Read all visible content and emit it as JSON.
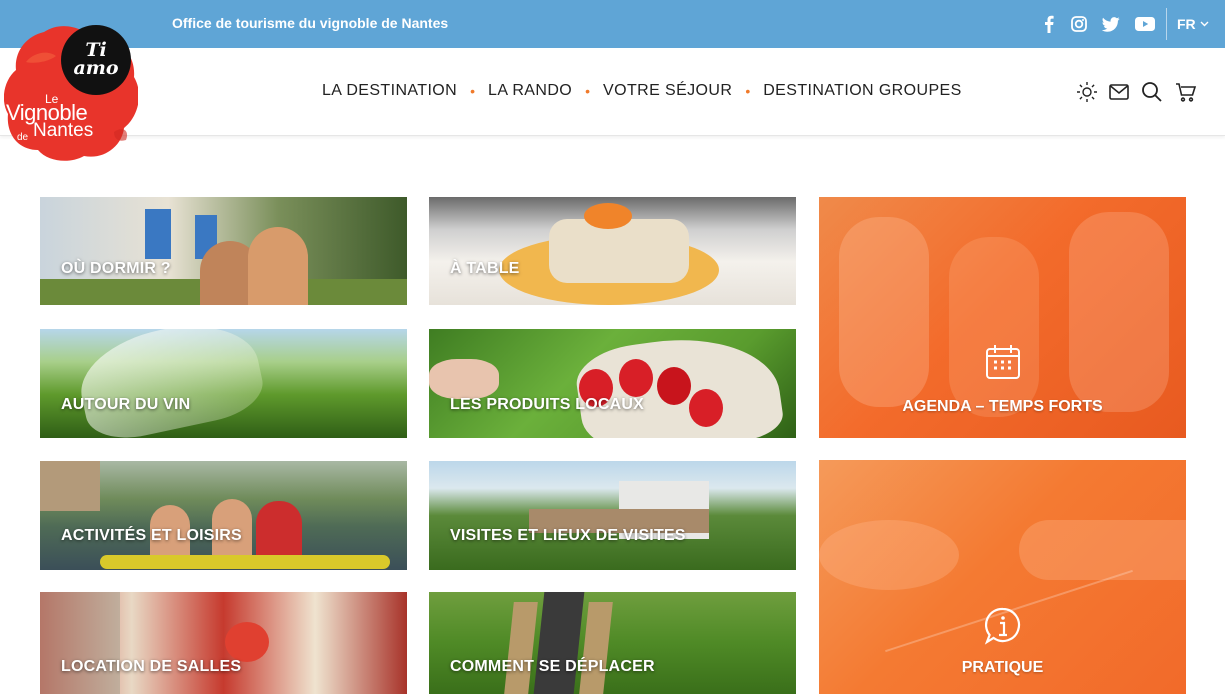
{
  "topbar": {
    "title": "Office de tourisme du vignoble de Nantes",
    "social": [
      "facebook-icon",
      "instagram-icon",
      "twitter-icon",
      "youtube-icon"
    ],
    "lang": "FR"
  },
  "logo": {
    "line1": "Ti",
    "line2": "amo",
    "le": "Le",
    "vignoble": "Vignoble",
    "de": "de",
    "nantes": "Nantes"
  },
  "nav": {
    "items": [
      "LA DESTINATION",
      "LA RANDO",
      "VOTRE SÉJOUR",
      "DESTINATION GROUPES"
    ],
    "separator": "•"
  },
  "header_icons": [
    "sun-icon",
    "mail-icon",
    "search-icon",
    "cart-icon"
  ],
  "tiles": [
    {
      "label": "OÙ DORMIR ?"
    },
    {
      "label": "À TABLE"
    },
    {
      "label": "AUTOUR DU VIN"
    },
    {
      "label": "LES PRODUITS LOCAUX"
    },
    {
      "label": "ACTIVITÉS ET LOISIRS"
    },
    {
      "label": "VISITES ET LIEUX DE VISITES"
    },
    {
      "label": "LOCATION DE SALLES"
    },
    {
      "label": "COMMENT SE DÉPLACER"
    }
  ],
  "big_tiles": [
    {
      "label": "AGENDA – TEMPS FORTS",
      "icon": "calendar-icon"
    },
    {
      "label": "PRATIQUE",
      "icon": "info-icon"
    }
  ],
  "colors": {
    "topbar": "#5fa5d6",
    "accent_orange": "#f26a2a",
    "logo_red": "#e8342b",
    "text_dark": "#222222"
  }
}
